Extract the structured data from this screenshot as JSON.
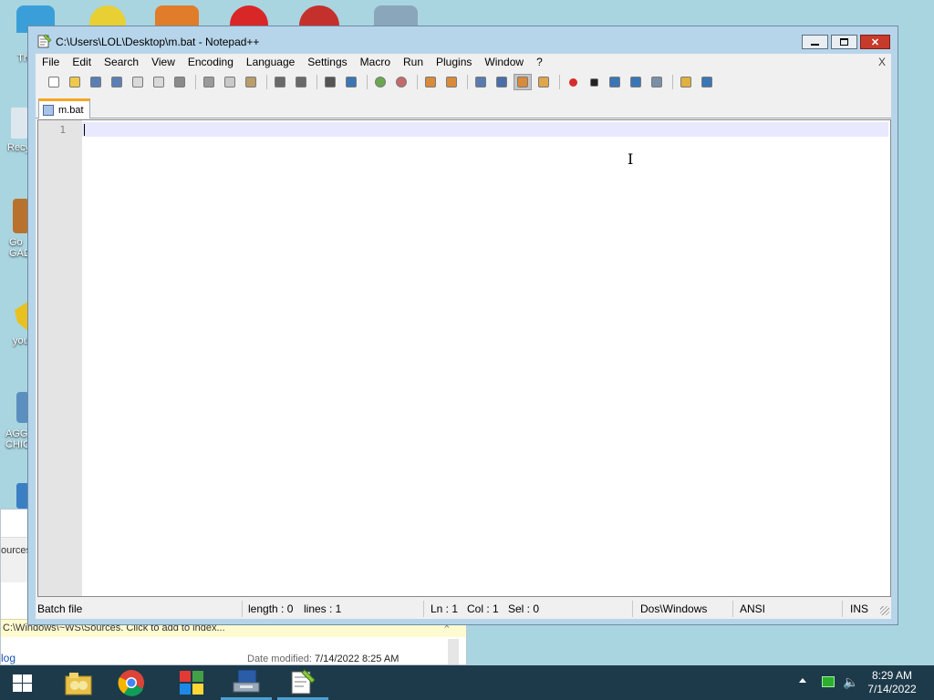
{
  "desktop": {
    "icons": [
      {
        "label": "Th",
        "color": "#3a7fc4"
      },
      {
        "label": "Recy",
        "color": "#8aa5b8"
      },
      {
        "label": "Go GAD",
        "color": "#c77a2a"
      },
      {
        "label": "you",
        "color": "#e8c120"
      },
      {
        "label": "AGG CHIC",
        "color": "#5a8fc0"
      }
    ]
  },
  "explorer": {
    "side_label": "ources",
    "address_hint": "C:\\Windows\\~WS\\Sources. Click to add to index...",
    "link_text": "log",
    "modified_label": "Date modified:",
    "modified_value": "7/14/2022 8:25 AM"
  },
  "notepad": {
    "title": "C:\\Users\\LOL\\Desktop\\m.bat - Notepad++",
    "menu": [
      "File",
      "Edit",
      "Search",
      "View",
      "Encoding",
      "Language",
      "Settings",
      "Macro",
      "Run",
      "Plugins",
      "Window",
      "?"
    ],
    "menu_close": "X",
    "toolbar": [
      "new-file-icon",
      "open-file-icon",
      "save-icon",
      "save-all-icon",
      "close-icon",
      "close-all-icon",
      "print-icon",
      "sep",
      "cut-icon",
      "copy-icon",
      "paste-icon",
      "sep",
      "undo-icon",
      "redo-icon",
      "sep",
      "find-icon",
      "replace-icon",
      "sep",
      "zoom-in-icon",
      "zoom-out-icon",
      "sep",
      "sync-vertical-icon",
      "sync-horizontal-icon",
      "sep",
      "word-wrap-icon",
      "show-all-chars-icon",
      "indent-guide-icon",
      "doc-map-icon",
      "sep",
      "record-macro-icon",
      "stop-record-icon",
      "play-macro-icon",
      "run-macro-multiple-icon",
      "save-macro-icon",
      "sep",
      "folder-workspace-icon",
      "spell-check-icon"
    ],
    "active_toolbar": "indent-guide-icon",
    "tab": {
      "label": "m.bat"
    },
    "editor": {
      "line_numbers": [
        "1"
      ],
      "content": ""
    },
    "status": {
      "file_type": "Batch file",
      "length": "length : 0",
      "lines": "lines : 1",
      "ln": "Ln : 1",
      "col": "Col : 1",
      "sel": "Sel : 0",
      "eol": "Dos\\Windows",
      "encoding": "ANSI",
      "mode": "INS"
    }
  },
  "taskbar": {
    "apps": [
      {
        "name": "file-explorer-icon",
        "running": false
      },
      {
        "name": "chrome-icon",
        "running": false
      },
      {
        "name": "windows-store-icon",
        "running": false
      },
      {
        "name": "network-app-icon",
        "running": true
      },
      {
        "name": "notepadpp-icon",
        "running": true
      }
    ],
    "clock_time": "8:29 AM",
    "clock_date": "7/14/2022"
  }
}
